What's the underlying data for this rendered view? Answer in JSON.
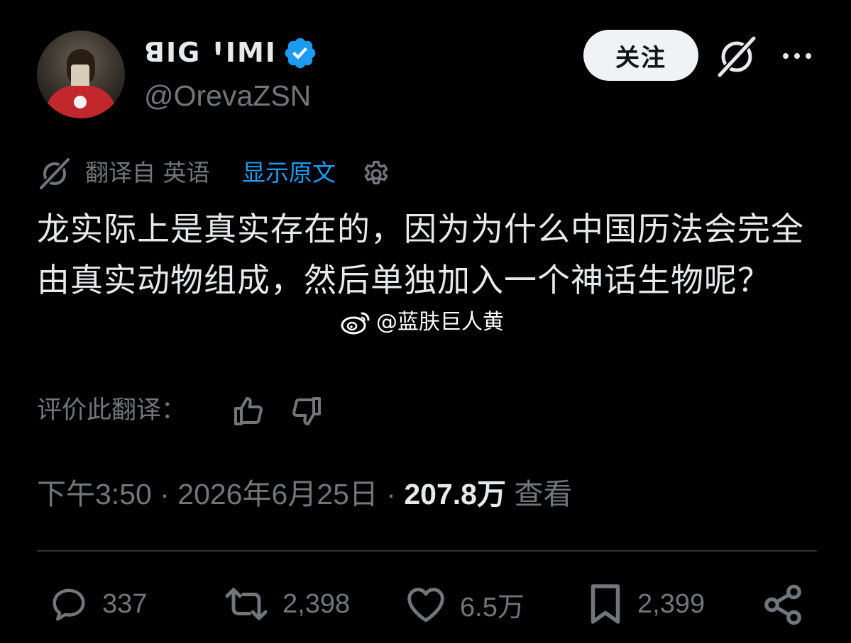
{
  "user": {
    "display_name": "ꓭIG ꞋIMI",
    "handle": "@OrevaZSN",
    "verified": true,
    "verified_color": "#1d9bf0"
  },
  "header": {
    "follow_label": "关注",
    "grok_icon": "grok-icon",
    "more_icon": "more-icon"
  },
  "translation": {
    "from_label": "翻译自 英语",
    "show_original_label": "显示原文",
    "settings_icon": "gear-icon"
  },
  "tweet": {
    "text": "龙实际上是真实存在的，因为为什么中国历法会完全由真实动物组成，然后单独加入一个神话生物呢？"
  },
  "watermark": {
    "text": "@蓝肤巨人黄"
  },
  "rate": {
    "label": "评价此翻译："
  },
  "meta": {
    "time": "下午3:50",
    "date": "2026年6月25日",
    "views_count": "207.8万",
    "views_label": "查看"
  },
  "actions": {
    "replies": "337",
    "reposts": "2,398",
    "likes": "6.5万",
    "bookmarks": "2,399"
  },
  "colors": {
    "background": "#000000",
    "text": "#e7e9ea",
    "muted": "#71767b",
    "accent": "#1d9bf0",
    "divider": "#2f3336"
  }
}
